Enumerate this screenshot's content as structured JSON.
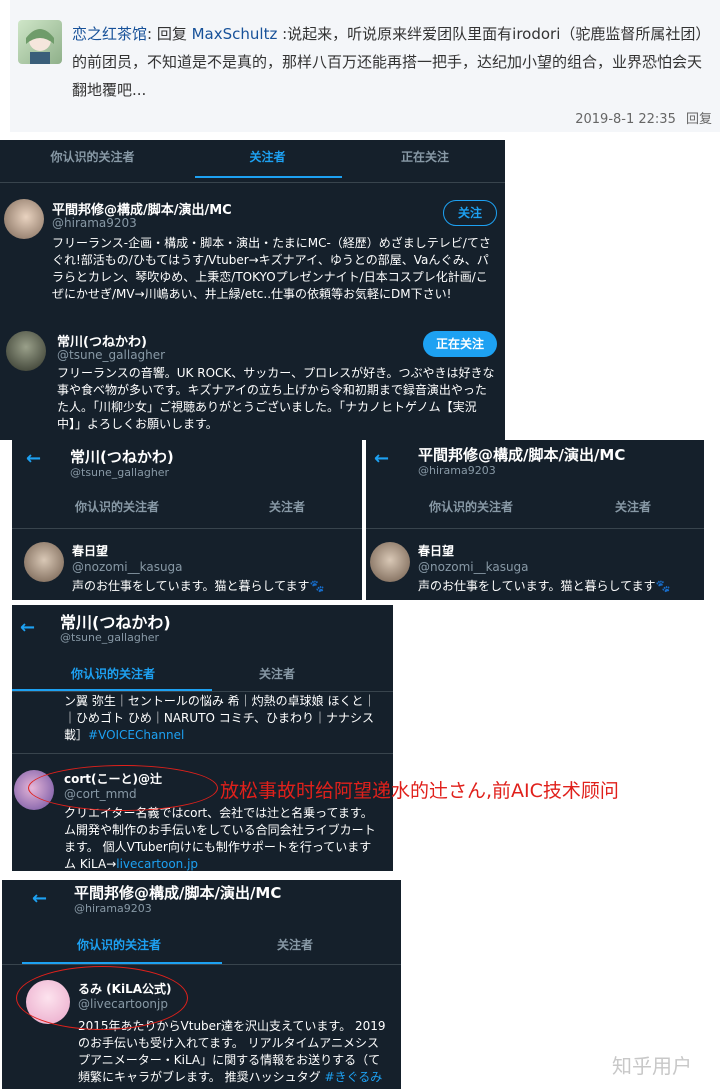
{
  "comment": {
    "author": "恋之红茶馆",
    "reply_prefix": ": 回复 ",
    "reply_to": "MaxSchultz",
    "text": " :说起来，听说原来绊爱团队里面有irodori（驼鹿监督所属社团）的前团员，不知道是不是真的，那样八百万还能再搭一把手，达纪加小望的组合，业界恐怕会天翻地覆吧...",
    "timestamp": "2019-8-1 22:35",
    "reply_label": "回复"
  },
  "panel1": {
    "tabs": [
      "你认识的关注者",
      "关注者",
      "正在关注"
    ],
    "user1": {
      "name": "平間邦修@構成/脚本/演出/MC",
      "handle": "@hirama9203",
      "button": "关注",
      "bio": "フリーランス-企画・構成・脚本・演出・たまにMC-（経歴）めざましテレビ/てさぐれ!部活もの/ひもてはうす/Vtuber→キズナアイ、ゆうとの部屋、Vaんぐみ、パラらとカレン、琴吹ゆめ、上秉恋/TOKYOプレゼンナイト/日本コスプレ化計画/こぜにかせぎ/MV→川嶋あい、井上緑/etc..仕事の依頼等お気軽にDM下さい!"
    },
    "user2": {
      "name": "常川(つねかわ)",
      "handle": "@tsune_gallagher",
      "button": "正在关注",
      "bio": "フリーランスの音響。UK ROCK、サッカー、プロレスが好き。つぶやきは好きな事や食べ物が多いです。キズナアイの立ち上げから令和初期まで録音演出やったた人。「川柳少女」ご視聴ありがとうございました。「ナカノヒトゲノム【実況中】」よろしくお願いします。"
    }
  },
  "panel2": {
    "title": "常川(つねかわ)",
    "subtitle": "@tsune_gallagher",
    "tabs": [
      "你认识的关注者",
      "关注者"
    ],
    "user": {
      "name": "春日望",
      "handle": "@nozomi__kasuga",
      "bio": "声のお仕事をしています。猫と暮らしてます🐾"
    }
  },
  "panel3": {
    "title": "平間邦修@構成/脚本/演出/MC",
    "subtitle": "@hirama9203",
    "tabs": [
      "你认识的关注者",
      "关注者"
    ],
    "user": {
      "name": "春日望",
      "handle": "@nozomi__kasuga",
      "bio": "声のお仕事をしています。猫と暮らしてます🐾"
    }
  },
  "panel4": {
    "title": "常川(つねかわ)",
    "subtitle": "@tsune_gallagher",
    "tabs": [
      "你认识的关注者",
      "关注者"
    ],
    "cut_lines": [
      "ン翼 弥生｜セントールの悩み 希｜灼熱の卓球娘 ほくと｜",
      "｜ひめゴト ひめ｜NARUTO コミチ、ひまわり｜ナナシス",
      "載］"
    ],
    "cut_link": "#VOICEChannel",
    "user": {
      "name": "cort(こーと)@辻",
      "handle": "@cort_mmd",
      "bio_lines": [
        "クリエイター名義ではcort、会社では辻と名乗ってます。",
        "ム開発や制作のお手伝いをしている合同会社ライブカート",
        "ます。 個人VTuber向けにも制作サポートを行っています",
        "ム KiLA→"
      ],
      "bio_link": "livecartoon.jp"
    },
    "annotation": "放松事故时给阿望递水的辻さん,前AIC技术顾问"
  },
  "panel5": {
    "title": "平間邦修@構成/脚本/演出/MC",
    "subtitle": "@hirama9203",
    "tabs": [
      "你认识的关注者",
      "关注者"
    ],
    "user": {
      "name": "るみ (KiLA公式)",
      "handle": "@livecartoonjp",
      "bio_lines": [
        "2015年あたりからVtuber達を沢山支えています。 2019",
        "のお手伝いも受け入れてます。 リアルタイムアニメシス",
        "プアニメーター・KiLA」に関する情報をお送りする（て",
        "頻繁にキャラがブレます。 推奨ハッシュタグ "
      ],
      "bio_link": "#きぐるみ"
    }
  },
  "watermark": "知乎用户",
  "colors": {
    "panel_bg": "#15202b",
    "accent": "#1da1f2",
    "annotation": "#e0201b",
    "comment_bg": "#f4f6f9"
  }
}
